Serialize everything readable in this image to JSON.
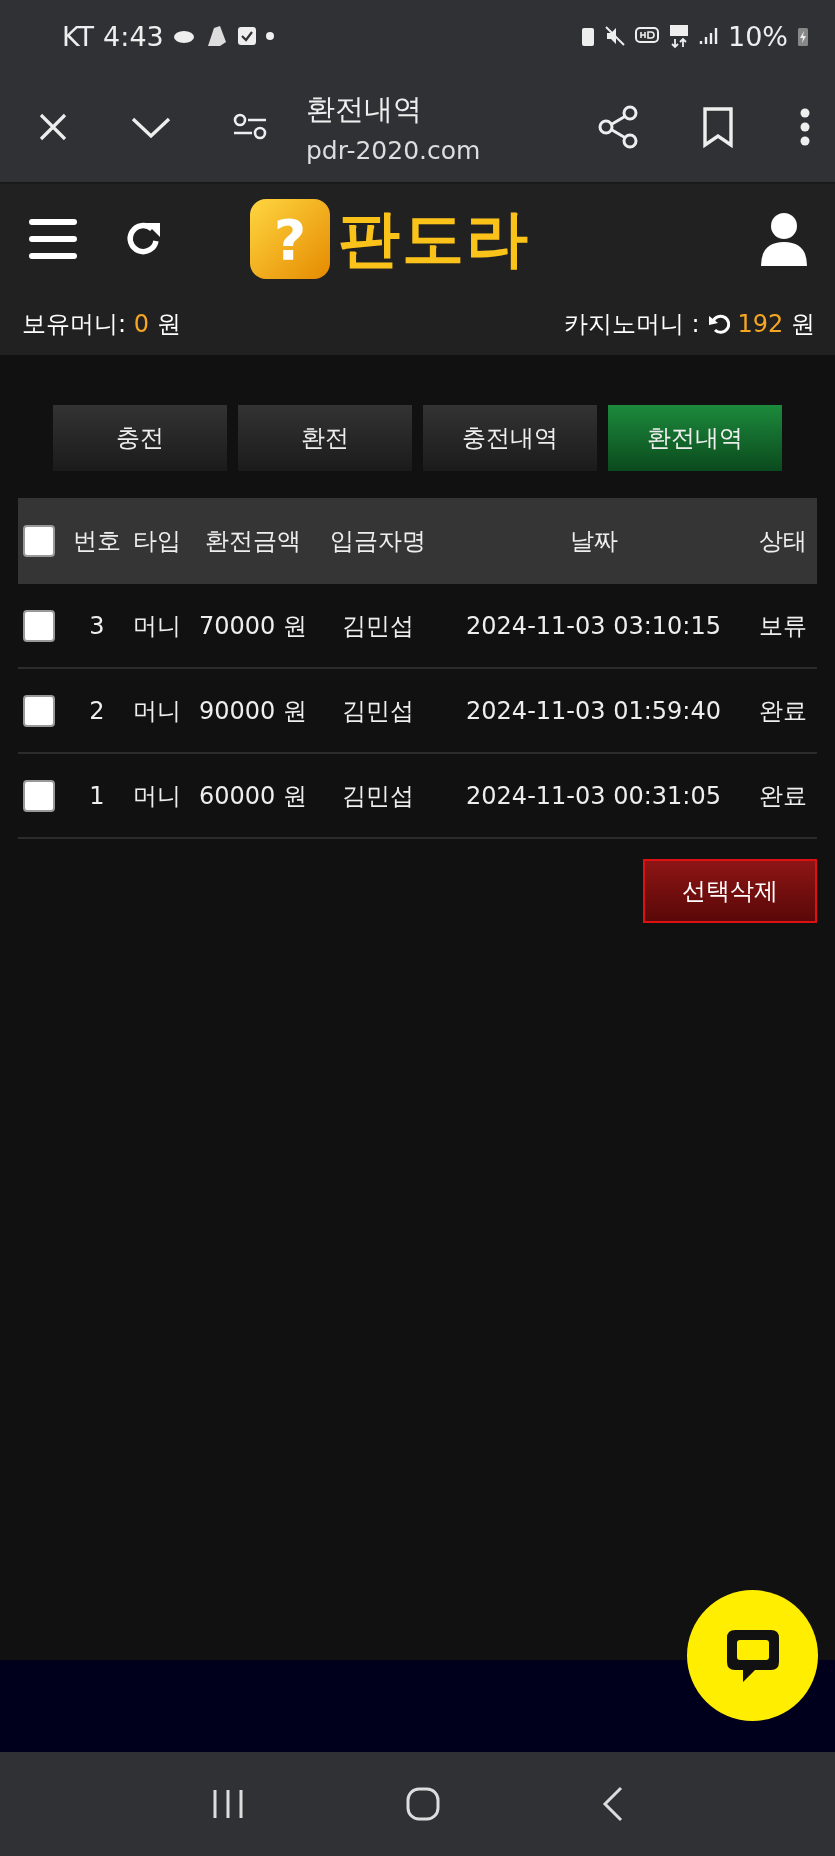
{
  "status_bar": {
    "carrier": "KT",
    "time": "4:43",
    "battery": "10%"
  },
  "browser_bar": {
    "title": "환전내역",
    "url": "pdr-2020.com"
  },
  "header": {
    "logo": {
      "glyph": "?",
      "text": "판도라"
    }
  },
  "balances": {
    "own_label": "보유머니:",
    "own_value": "0",
    "own_unit": "원",
    "casino_label": "카지노머니 :",
    "casino_value": "192",
    "casino_unit": "원"
  },
  "tabs": [
    {
      "label": "충전",
      "selected": false
    },
    {
      "label": "환전",
      "selected": false
    },
    {
      "label": "충전내역",
      "selected": false
    },
    {
      "label": "환전내역",
      "selected": true
    }
  ],
  "table": {
    "select_all_checked": false,
    "columns": [
      "번호",
      "타입",
      "환전금액",
      "입금자명",
      "날짜",
      "상태"
    ],
    "rows": [
      {
        "checked": false,
        "cells": [
          "3",
          "머니",
          "70000 원",
          "김민섭",
          "2024-11-03 03:10:15",
          "보류"
        ]
      },
      {
        "checked": false,
        "cells": [
          "2",
          "머니",
          "90000 원",
          "김민섭",
          "2024-11-03 01:59:40",
          "완료"
        ]
      },
      {
        "checked": false,
        "cells": [
          "1",
          "머니",
          "60000 원",
          "김민섭",
          "2024-11-03 00:31:05",
          "완료"
        ]
      }
    ]
  },
  "delete_button": "선택삭제"
}
